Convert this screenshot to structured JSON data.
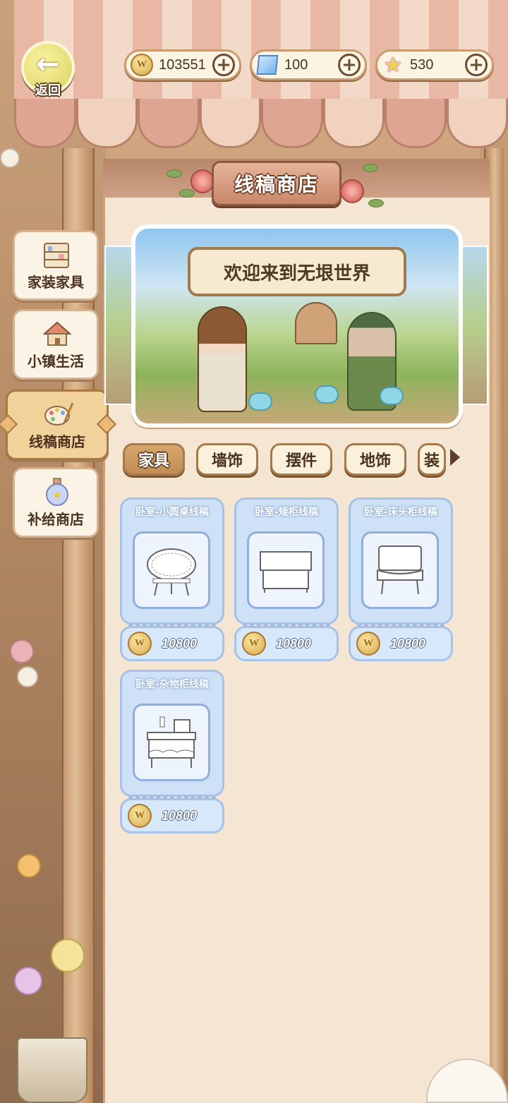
{
  "header": {
    "back_label": "返回",
    "currencies": [
      {
        "name": "coin",
        "value": "103551",
        "icon": "coin-icon"
      },
      {
        "name": "crystal",
        "value": "100",
        "icon": "crystal-cube-icon"
      },
      {
        "name": "star",
        "value": "530",
        "icon": "star-icon"
      }
    ]
  },
  "shop": {
    "title": "线稿商店",
    "banner_text": "欢迎来到无垠世界"
  },
  "sidebar": {
    "items": [
      {
        "label": "家装家具",
        "icon": "furniture-shelf-icon",
        "active": false
      },
      {
        "label": "小镇生活",
        "icon": "town-house-icon",
        "active": false
      },
      {
        "label": "线稿商店",
        "icon": "palette-icon",
        "active": true
      },
      {
        "label": "补给商店",
        "icon": "potion-bottle-icon",
        "active": false
      }
    ]
  },
  "tabs": [
    {
      "label": "家具",
      "active": true
    },
    {
      "label": "墙饰",
      "active": false
    },
    {
      "label": "摆件",
      "active": false
    },
    {
      "label": "地饰",
      "active": false
    },
    {
      "label": "装",
      "active": false
    }
  ],
  "items": [
    {
      "name": "卧室-小圆桌线稿",
      "price": "10800",
      "icon": "round-table-sketch-icon"
    },
    {
      "name": "卧室-矮柜线稿",
      "price": "10800",
      "icon": "low-cabinet-sketch-icon"
    },
    {
      "name": "卧室-床头柜线稿",
      "price": "10800",
      "icon": "nightstand-sketch-icon"
    },
    {
      "name": "卧室-杂物柜线稿",
      "price": "10800",
      "icon": "storage-shelf-sketch-icon"
    }
  ],
  "colors": {
    "card_blue": "#cfe1f6",
    "panel": "#f4e6d3",
    "active_tab": "#c38d53"
  }
}
